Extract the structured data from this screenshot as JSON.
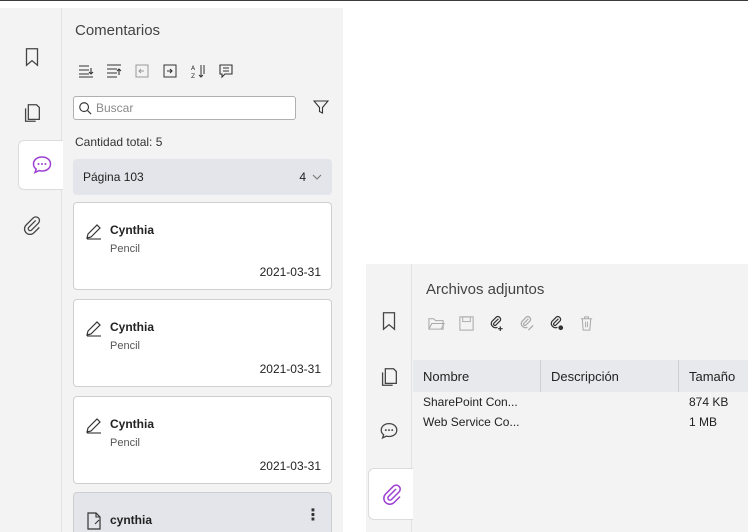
{
  "comments_panel": {
    "title": "Comentarios",
    "search_placeholder": "Buscar",
    "total_label": "Cantidad total: 5",
    "page_group": {
      "label": "Página 103",
      "count": "4"
    },
    "cards": [
      {
        "author": "Cynthia",
        "type": "Pencil",
        "date": "2021-03-31",
        "icon": "pencil-icon"
      },
      {
        "author": "Cynthia",
        "type": "Pencil",
        "date": "2021-03-31",
        "icon": "pencil-icon"
      },
      {
        "author": "Cynthia",
        "type": "Pencil",
        "date": "2021-03-31",
        "icon": "pencil-icon"
      },
      {
        "author": "cynthia",
        "more": "⋮",
        "icon": "note-icon"
      }
    ]
  },
  "attachments_panel": {
    "title": "Archivos adjuntos",
    "columns": [
      "Nombre",
      "Descripción",
      "Tamaño"
    ],
    "rows": [
      {
        "name": "SharePoint Con...",
        "description": "",
        "size": "874 KB"
      },
      {
        "name": "Web Service Co...",
        "description": "",
        "size": "1 MB"
      }
    ]
  },
  "colors": {
    "accent": "#9c3fd2",
    "panel_bg": "#f3f3f3",
    "selected_bg": "#e3e5ea"
  }
}
